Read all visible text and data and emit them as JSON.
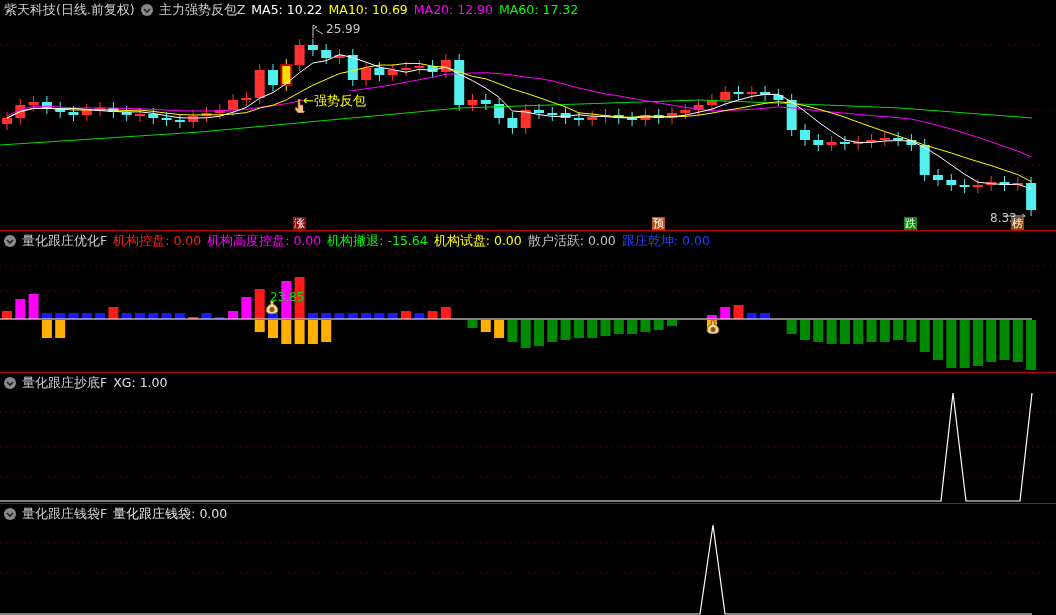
{
  "title_bar": {
    "stock": "紫天科技(日线.前复权)",
    "indicator": "主力强势反包Z",
    "ma": [
      {
        "label": "MA5: 10.22",
        "color": "#ffffff"
      },
      {
        "label": "MA10: 10.69",
        "color": "#ffff00"
      },
      {
        "label": "MA20: 12.90",
        "color": "#ff00ff"
      },
      {
        "label": "MA60: 17.32",
        "color": "#00ff00"
      }
    ]
  },
  "price_chart": {
    "high_label": "25.99",
    "low_label": "8.33",
    "annotation": "←强势反包",
    "signals": [
      {
        "text": "涨",
        "color": "#8b0a0a"
      },
      {
        "text": "预",
        "color": "#c0501a"
      },
      {
        "text": "跌",
        "color": "#108a10"
      },
      {
        "text": "榜",
        "color": "#8a4a10"
      }
    ]
  },
  "panels": [
    {
      "kind": "bars",
      "name": "量化跟庄优化F",
      "values": [
        {
          "label": "机构控盘: 0.00",
          "color": "#ff2020"
        },
        {
          "label": "机构高度控盘: 0.00",
          "color": "#ff00ff"
        },
        {
          "label": "机构撤退: -15.64",
          "color": "#00ff00"
        },
        {
          "label": "机构试盘: 0.00",
          "color": "#ffff00"
        },
        {
          "label": "散户活跃: 0.00",
          "color": "#c0c0c0"
        },
        {
          "label": "跟庄乾坤: 0.00",
          "color": "#2040ff"
        }
      ],
      "bar_label": "23.85"
    },
    {
      "kind": "bottom",
      "name": "量化跟庄抄底F",
      "values": [
        {
          "label": "XG: 1.00",
          "color": "#e0e0e0"
        }
      ]
    },
    {
      "kind": "bag",
      "name": "量化跟庄钱袋F",
      "values": [
        {
          "label": "量化跟庄钱袋: 0.00",
          "color": "#e0e0e0"
        }
      ]
    }
  ]
}
